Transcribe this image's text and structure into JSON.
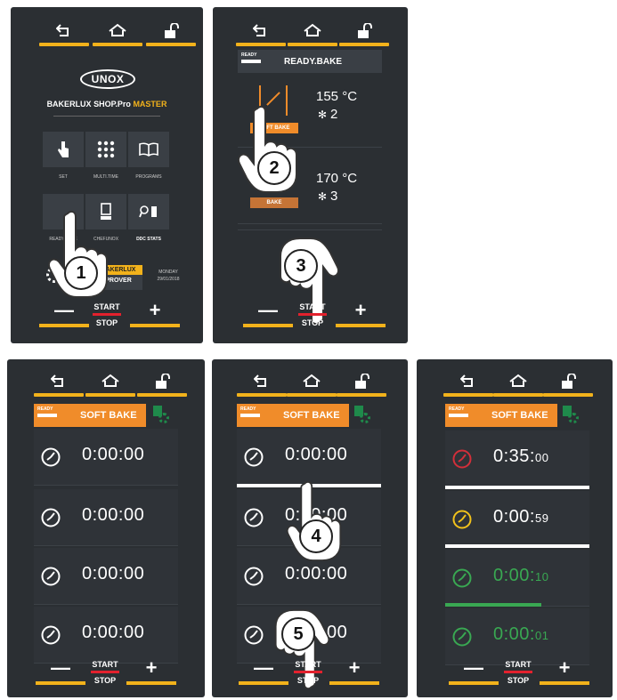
{
  "nav": {
    "back_icon": "back-arrow-icon",
    "home_icon": "home-icon",
    "lock_icon": "unlock-icon"
  },
  "controls": {
    "minus": "—",
    "plus": "+",
    "start": "START",
    "stop": "STOP"
  },
  "colors": {
    "accent": "#f2b21b",
    "orange": "#f08c2a",
    "red": "#e3212d",
    "green": "#1f8a4b",
    "panel": "#2b2f33"
  },
  "panel1": {
    "logo": "UNOX",
    "brand_left": "BAKERLUX SHOP.Pro",
    "brand_right": "MASTER",
    "tiles": [
      {
        "label": "SET",
        "icon": "hand-icon"
      },
      {
        "label": "MULTI.TIME",
        "icon": "grid-icon"
      },
      {
        "label": "PROGRAMS",
        "icon": "book-icon"
      },
      {
        "label": "READY.BAKE",
        "icon": "ready-icon"
      },
      {
        "label": "CHEFUNOX",
        "icon": "chef-icon"
      },
      {
        "label": "DDC STATS",
        "icon": "stats-icon"
      }
    ],
    "prover_line1": "BAKERLUX",
    "prover_line2": "PROVER",
    "date_line1": "MONDAY",
    "date_line2": "29/01/2018",
    "step": "1"
  },
  "panel2": {
    "header": "READY.BAKE",
    "ready_label": "READY",
    "programs": [
      {
        "temp": "155 °C",
        "fan": "2",
        "label": "SOFT BAKE"
      },
      {
        "temp": "170 °C",
        "fan": "3",
        "label": "BAKE"
      }
    ],
    "step_a": "2",
    "step_b": "3"
  },
  "panel3": {
    "header": "SOFT BAKE",
    "ready_label": "READY",
    "timers": [
      "0:00:00",
      "0:00:00",
      "0:00:00",
      "0:00:00"
    ]
  },
  "panel4": {
    "header": "SOFT BAKE",
    "ready_label": "READY",
    "timers": [
      "0:00:00",
      "0:00:00",
      "0:00:00",
      "0:00:00"
    ],
    "step_a": "4",
    "step_b": "5"
  },
  "panel5": {
    "header": "SOFT BAKE",
    "ready_label": "READY",
    "timers": [
      {
        "main": "0:35:",
        "sec": "00",
        "color": "#d22f3a"
      },
      {
        "main": "0:00:",
        "sec": "59",
        "color": "#f2c21b"
      },
      {
        "main": "0:00:",
        "sec": "10",
        "color": "#39a852"
      },
      {
        "main": "0:00:",
        "sec": "01",
        "color": "#39a852"
      }
    ]
  }
}
